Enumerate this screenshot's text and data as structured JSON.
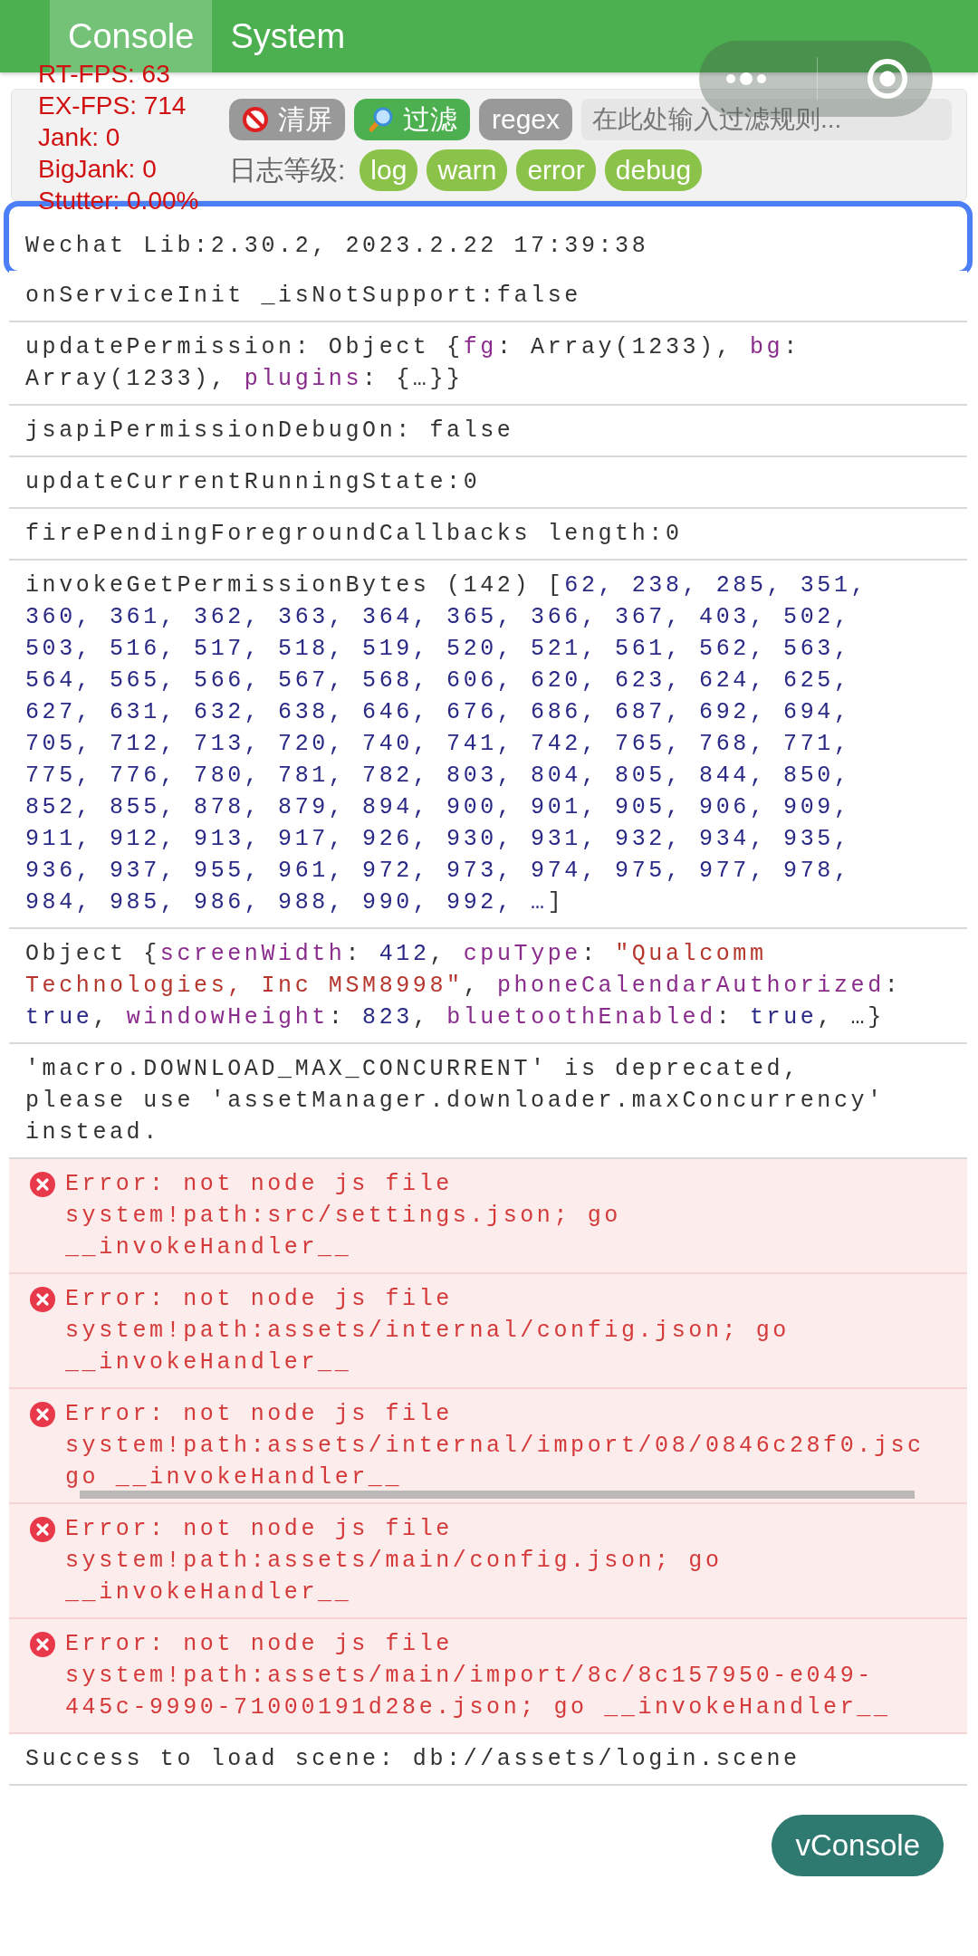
{
  "tabs": [
    {
      "label": "Console",
      "selected": true
    },
    {
      "label": "System",
      "selected": false
    }
  ],
  "stats": [
    "RT-FPS: 63",
    "EX-FPS: 714",
    "Jank: 0",
    "BigJank: 0",
    "Stutter: 0.00%"
  ],
  "toolbar": {
    "clear_button": "清屏",
    "filter_button": "过滤",
    "regex": {
      "label": "regex",
      "on": false
    },
    "filter_field": {
      "placeholder": "在此处输入过滤规则..."
    },
    "level_label": "日志等级:",
    "levels": [
      {
        "label": "log",
        "on": true
      },
      {
        "label": "warn",
        "on": true
      },
      {
        "label": "error",
        "on": true
      },
      {
        "label": "debug",
        "on": true
      }
    ]
  },
  "logs": [
    {
      "kind": "log",
      "highlighted": true,
      "parts": [
        {
          "kind": "plain",
          "text": "Wechat Lib:2.30.2, 2023.2.22 17:39:38"
        }
      ]
    },
    {
      "kind": "log",
      "highlighted": false,
      "parts": [
        {
          "kind": "plain",
          "text": "onServiceInit _isNotSupport:false"
        }
      ]
    },
    {
      "kind": "log",
      "highlighted": false,
      "parts": [
        {
          "kind": "plain",
          "text": "updatePermission: Object {"
        },
        {
          "kind": "key",
          "text": "fg"
        },
        {
          "kind": "plain",
          "text": ": Array(1233), "
        },
        {
          "kind": "key",
          "text": "bg"
        },
        {
          "kind": "plain",
          "text": ":\nArray(1233), "
        },
        {
          "kind": "key",
          "text": "plugins"
        },
        {
          "kind": "plain",
          "text": ": {…}}"
        }
      ]
    },
    {
      "kind": "log",
      "highlighted": false,
      "parts": [
        {
          "kind": "plain",
          "text": "jsapiPermissionDebugOn: false"
        }
      ]
    },
    {
      "kind": "log",
      "highlighted": false,
      "parts": [
        {
          "kind": "plain",
          "text": "updateCurrentRunningState:0"
        }
      ]
    },
    {
      "kind": "log",
      "highlighted": false,
      "parts": [
        {
          "kind": "plain",
          "text": "firePendingForegroundCallbacks length:0"
        }
      ]
    },
    {
      "kind": "log",
      "highlighted": false,
      "parts": [
        {
          "kind": "plain",
          "text": "invokeGetPermissionBytes (142) ["
        },
        {
          "kind": "number",
          "text": "62, 238, 285, 351,\n360, 361, 362, 363, 364, 365, 366, 367, 403, 502,\n503, 516, 517, 518, 519, 520, 521, 561, 562, 563,\n564, 565, 566, 567, 568, 606, 620, 623, 624, 625,\n627, 631, 632, 638, 646, 676, 686, 687, 692, 694,\n705, 712, 713, 720, 740, 741, 742, 765, 768, 771,\n775, 776, 780, 781, 782, 803, 804, 805, 844, 850,\n852, 855, 878, 879, 894, 900, 901, 905, 906, 909,\n911, 912, 913, 917, 926, 930, 931, 932, 934, 935,\n936, 937, 955, 961, 972, 973, 974, 975, 977, 978,\n984, 985, 986, 988, 990, 992, …"
        },
        {
          "kind": "plain",
          "text": "]"
        }
      ]
    },
    {
      "kind": "log",
      "highlighted": false,
      "parts": [
        {
          "kind": "plain",
          "text": "Object {"
        },
        {
          "kind": "key",
          "text": "screenWidth"
        },
        {
          "kind": "plain",
          "text": ": "
        },
        {
          "kind": "number",
          "text": "412"
        },
        {
          "kind": "plain",
          "text": ", "
        },
        {
          "kind": "key",
          "text": "cpuType"
        },
        {
          "kind": "plain",
          "text": ": "
        },
        {
          "kind": "string",
          "text": "\"Qualcomm\nTechnologies, Inc MSM8998\""
        },
        {
          "kind": "plain",
          "text": ", "
        },
        {
          "kind": "key",
          "text": "phoneCalendarAuthorized"
        },
        {
          "kind": "plain",
          "text": ":\n"
        },
        {
          "kind": "number",
          "text": "true"
        },
        {
          "kind": "plain",
          "text": ", "
        },
        {
          "kind": "key",
          "text": "windowHeight"
        },
        {
          "kind": "plain",
          "text": ": "
        },
        {
          "kind": "number",
          "text": "823"
        },
        {
          "kind": "plain",
          "text": ", "
        },
        {
          "kind": "key",
          "text": "bluetoothEnabled"
        },
        {
          "kind": "plain",
          "text": ": "
        },
        {
          "kind": "number",
          "text": "true"
        },
        {
          "kind": "plain",
          "text": ", …}"
        }
      ]
    },
    {
      "kind": "log",
      "highlighted": false,
      "parts": [
        {
          "kind": "plain",
          "text": "'macro.DOWNLOAD_MAX_CONCURRENT' is deprecated,\nplease use 'assetManager.downloader.maxConcurrency'\ninstead."
        }
      ]
    },
    {
      "kind": "error",
      "highlighted": false,
      "parts": [
        {
          "kind": "plain",
          "text": "Error: not node js file\nsystem!path:src/settings.json; go\n__invokeHandler__"
        }
      ]
    },
    {
      "kind": "error",
      "highlighted": false,
      "parts": [
        {
          "kind": "plain",
          "text": "Error: not node js file\nsystem!path:assets/internal/config.json; go\n__invokeHandler__"
        }
      ]
    },
    {
      "kind": "error",
      "highlighted": false,
      "scrollbar": true,
      "parts": [
        {
          "kind": "plain",
          "text": "Error: not node js file\nsystem!path:assets/internal/import/08/0846c28f0.jsc\ngo __invokeHandler__"
        }
      ]
    },
    {
      "kind": "error",
      "highlighted": false,
      "parts": [
        {
          "kind": "plain",
          "text": "Error: not node js file\nsystem!path:assets/main/config.json; go\n__invokeHandler__"
        }
      ]
    },
    {
      "kind": "error",
      "highlighted": false,
      "parts": [
        {
          "kind": "plain",
          "text": "Error: not node js file\nsystem!path:assets/main/import/8c/8c157950-e049-\n445c-9990-71000191d28e.json; go __invokeHandler__"
        }
      ]
    },
    {
      "kind": "log",
      "highlighted": false,
      "parts": [
        {
          "kind": "plain",
          "text": "Success to load scene: db://assets/login.scene"
        }
      ]
    }
  ],
  "vconsole_button": "vConsole"
}
